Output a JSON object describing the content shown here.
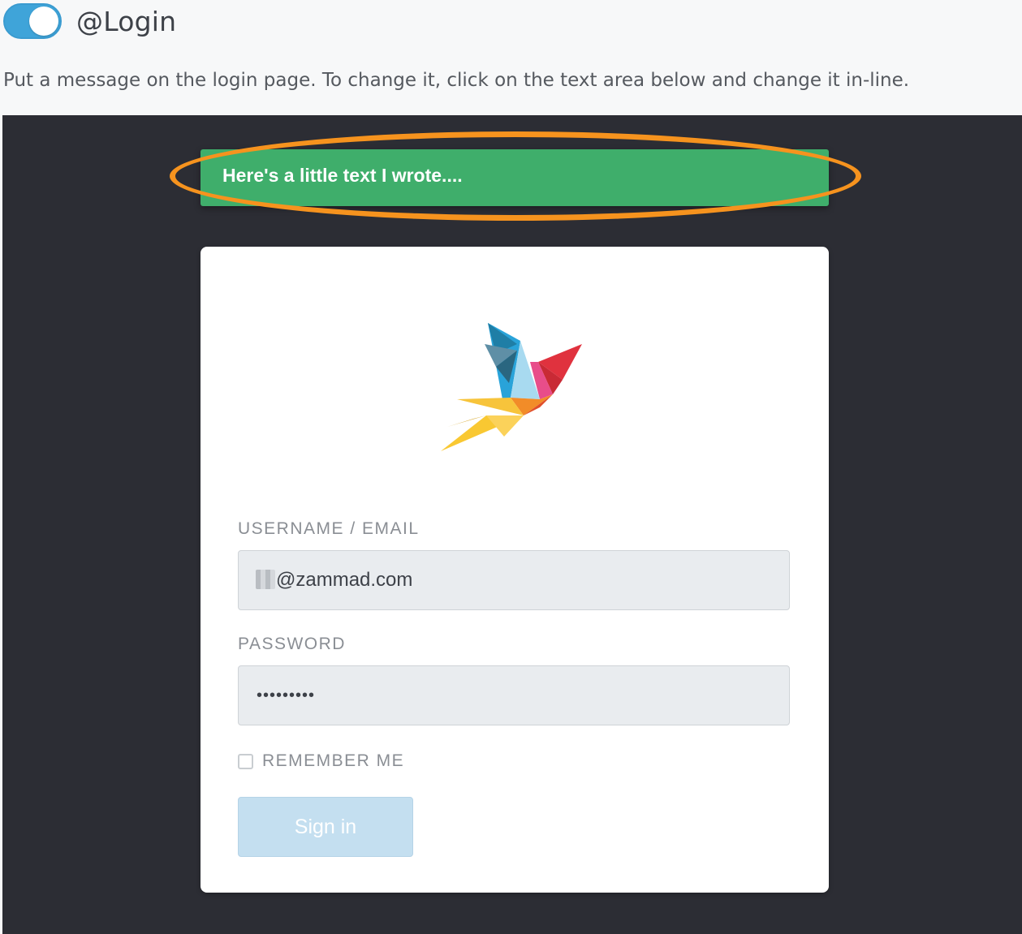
{
  "header": {
    "toggle_state": "on",
    "title": "@Login"
  },
  "description": "Put a message on the login page. To change it, click on the text area below and change it in-line.",
  "preview": {
    "message": "Here's a little text I wrote....",
    "logo": "zammad-bird-logo",
    "username_label": "USERNAME / EMAIL",
    "username_value": "@zammad.com",
    "password_label": "PASSWORD",
    "password_value": "•••••••••",
    "remember_label": "REMEMBER ME",
    "signin_label": "Sign in"
  },
  "colors": {
    "toggle": "#3fa4d9",
    "preview_background": "#2c2d34",
    "message_bar": "#3fae6b",
    "highlight_ring": "#f6931e",
    "signin_button": "#c4dff0"
  }
}
